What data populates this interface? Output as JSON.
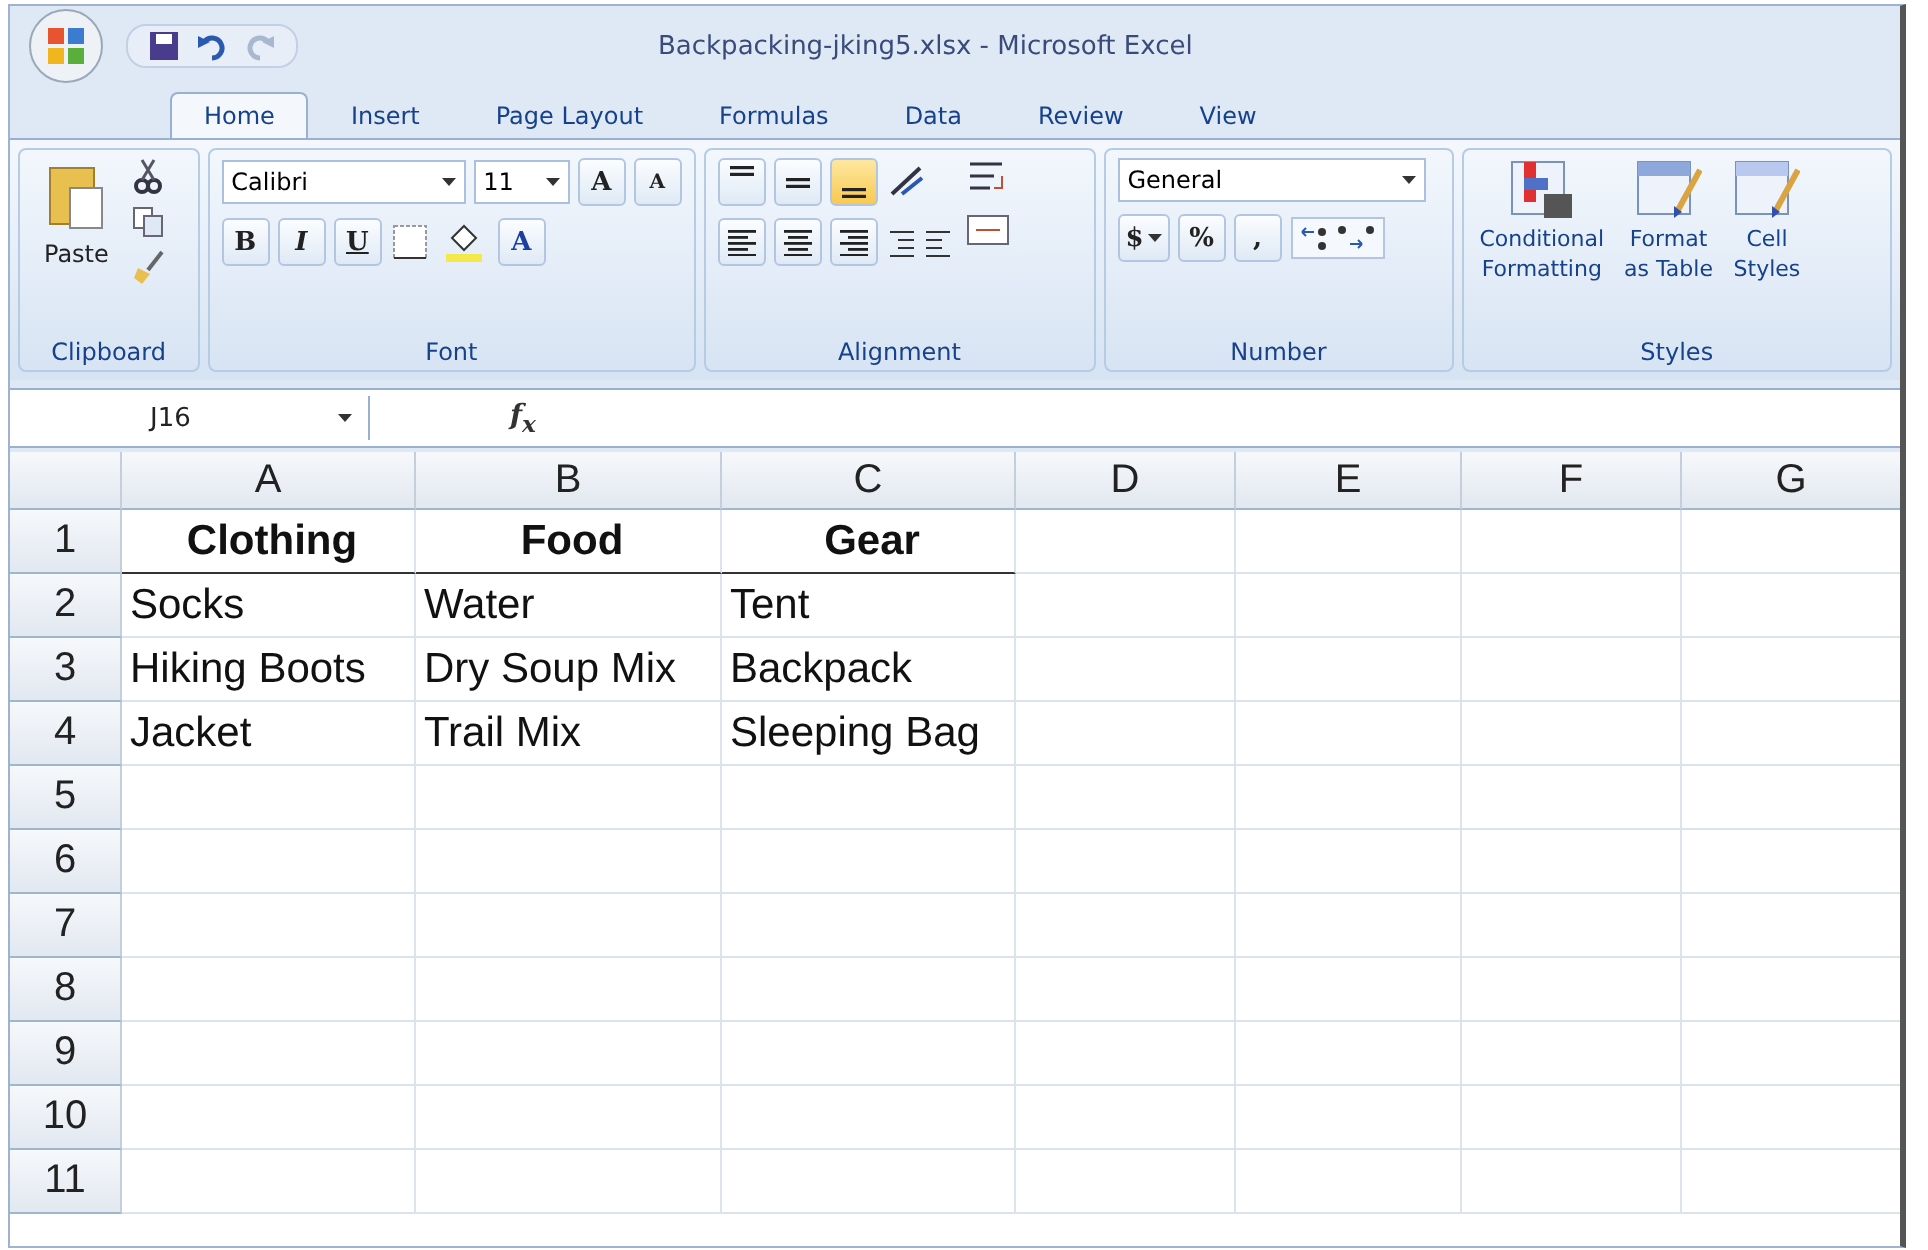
{
  "window": {
    "title": "Backpacking-jking5.xlsx - Microsoft Excel"
  },
  "tabs": [
    {
      "label": "Home",
      "selected": true
    },
    {
      "label": "Insert",
      "selected": false
    },
    {
      "label": "Page Layout",
      "selected": false
    },
    {
      "label": "Formulas",
      "selected": false
    },
    {
      "label": "Data",
      "selected": false
    },
    {
      "label": "Review",
      "selected": false
    },
    {
      "label": "View",
      "selected": false
    }
  ],
  "ribbon": {
    "clipboard": {
      "label": "Clipboard",
      "paste": "Paste"
    },
    "font": {
      "label": "Font",
      "name": "Calibri",
      "size": "11",
      "grow": "A",
      "shrink": "A",
      "bold": "B",
      "italic": "I",
      "underline": "U",
      "font_color": "A"
    },
    "alignment": {
      "label": "Alignment",
      "vertical": [
        {
          "kind": "top",
          "selected": false
        },
        {
          "kind": "middle",
          "selected": false
        },
        {
          "kind": "bottom",
          "selected": true
        }
      ]
    },
    "number": {
      "label": "Number",
      "format": "General",
      "currency": "$",
      "percent": "%",
      "comma": ","
    },
    "styles": {
      "label": "Styles",
      "buttons": [
        {
          "kind": "conditional",
          "lines": [
            "Conditional",
            "Formatting"
          ]
        },
        {
          "kind": "table",
          "lines": [
            "Format",
            "as Table"
          ]
        },
        {
          "kind": "cell",
          "lines": [
            "Cell",
            "Styles"
          ]
        }
      ]
    }
  },
  "formula_bar": {
    "name_box": "J16",
    "fx": "f$_{x}$"
  },
  "sheet": {
    "columns": [
      "A",
      "B",
      "C",
      "D",
      "E",
      "F",
      "G"
    ],
    "rows": [
      {
        "number": "1",
        "header": true,
        "cells": [
          "Clothing",
          "Food",
          "Gear"
        ]
      },
      {
        "number": "2",
        "header": false,
        "cells": [
          "Socks",
          "Water",
          "Tent"
        ]
      },
      {
        "number": "3",
        "header": false,
        "cells": [
          "Hiking Boots",
          "Dry Soup Mix",
          "Backpack"
        ]
      },
      {
        "number": "4",
        "header": false,
        "cells": [
          "Jacket",
          "Trail Mix",
          "Sleeping Bag"
        ]
      },
      {
        "number": "5"
      },
      {
        "number": "6"
      },
      {
        "number": "7"
      },
      {
        "number": "8"
      },
      {
        "number": "9"
      },
      {
        "number": "10"
      },
      {
        "number": "11"
      }
    ]
  }
}
